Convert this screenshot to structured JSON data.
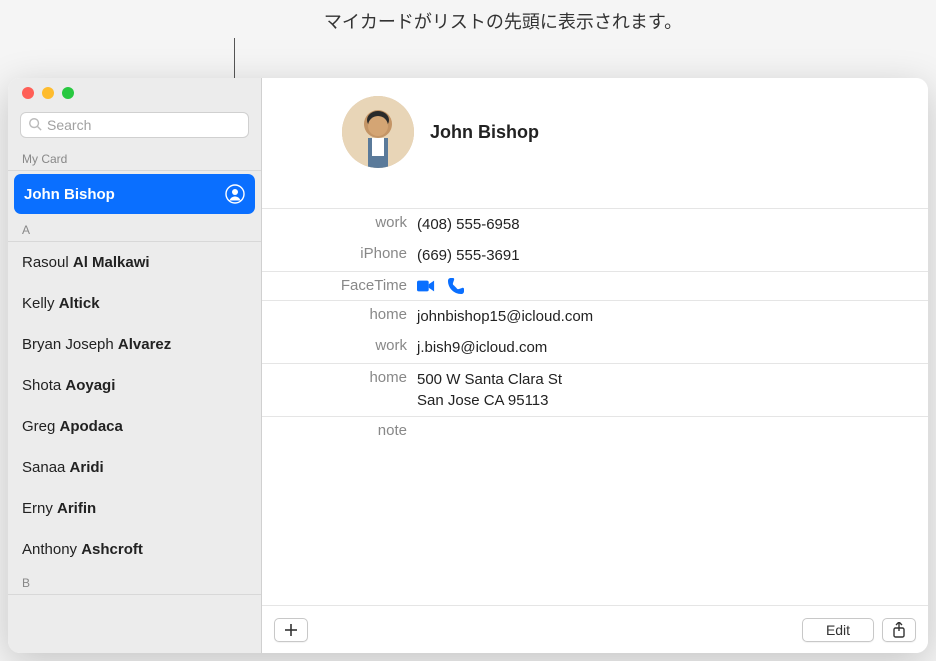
{
  "callout_text": "マイカードがリストの先頭に表示されます。",
  "search": {
    "placeholder": "Search"
  },
  "sidebar": {
    "my_card_header": "My Card",
    "my_card_name": "John Bishop",
    "section_a": "A",
    "section_b": "B",
    "contacts": [
      {
        "first": "Rasoul ",
        "last": "Al Malkawi"
      },
      {
        "first": "Kelly ",
        "last": "Altick"
      },
      {
        "first": "Bryan Joseph ",
        "last": "Alvarez"
      },
      {
        "first": "Shota ",
        "last": "Aoyagi"
      },
      {
        "first": "Greg ",
        "last": "Apodaca"
      },
      {
        "first": "Sanaa ",
        "last": "Aridi"
      },
      {
        "first": "Erny ",
        "last": "Arifin"
      },
      {
        "first": "Anthony ",
        "last": "Ashcroft"
      }
    ]
  },
  "detail": {
    "name": "John Bishop",
    "fields": {
      "work_phone_label": "work",
      "work_phone_value": "(408) 555-6958",
      "iphone_label": "iPhone",
      "iphone_value": "(669) 555-3691",
      "facetime_label": "FaceTime",
      "home_email_label": "home",
      "home_email_value": "johnbishop15@icloud.com",
      "work_email_label": "work",
      "work_email_value": "j.bish9@icloud.com",
      "home_addr_label": "home",
      "home_addr_line1": "500 W Santa Clara St",
      "home_addr_line2": "San Jose CA 95113",
      "note_label": "note"
    }
  },
  "toolbar": {
    "edit_label": "Edit"
  }
}
